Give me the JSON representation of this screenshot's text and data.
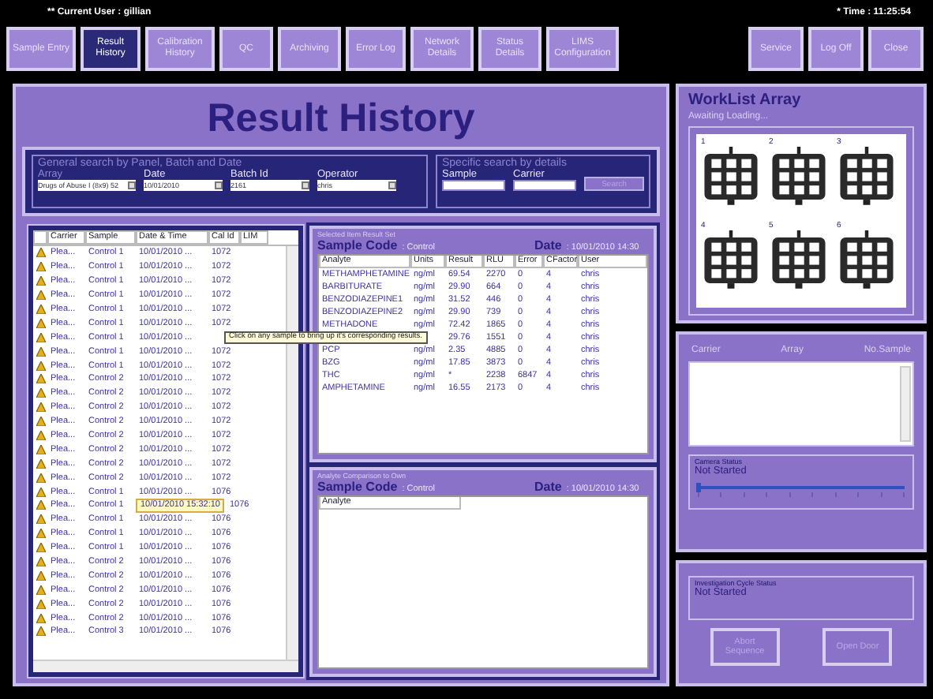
{
  "header": {
    "current_user": "** Current User : gillian",
    "time": "* Time : 11:25:54"
  },
  "nav": [
    {
      "label": "Sample Entry",
      "selected": false
    },
    {
      "label": "Result History",
      "selected": true
    },
    {
      "label": "Calibration History",
      "selected": false
    },
    {
      "label": "QC",
      "selected": false
    },
    {
      "label": "Archiving",
      "selected": false
    },
    {
      "label": "Error Log",
      "selected": false
    },
    {
      "label": "Network Details",
      "selected": false
    },
    {
      "label": "Status Details",
      "selected": false
    },
    {
      "label": "LIMS Configuration",
      "selected": false
    }
  ],
  "nav_right": [
    {
      "label": "Service"
    },
    {
      "label": "Log Off"
    },
    {
      "label": "Close"
    }
  ],
  "title": "Result History",
  "general_search": {
    "legend": "General search by Panel, Batch and Date",
    "fields": [
      {
        "label": "Array",
        "value": "Drugs of Abuse I (8x9) 52"
      },
      {
        "label": "Date",
        "value": "10/01/2010"
      },
      {
        "label": "Batch Id",
        "value": "2161"
      },
      {
        "label": "Operator",
        "value": "chris"
      }
    ]
  },
  "specific_search": {
    "legend": "Specific search by details",
    "fields": [
      {
        "label": "Sample"
      },
      {
        "label": "Carrier"
      }
    ],
    "button": {
      "label": "Search",
      "disabled": true
    }
  },
  "sample_list": {
    "columns": [
      "Carrier",
      "Sample",
      "Date & Time",
      "Cal Id",
      "LIM"
    ],
    "rows": [
      {
        "carrier": "Plea...",
        "sample": "Control 1",
        "datetime": "10/01/2010 ...",
        "cal_id": "1072",
        "selected": false
      },
      {
        "carrier": "Plea...",
        "sample": "Control 1",
        "datetime": "10/01/2010 ...",
        "cal_id": "1072",
        "selected": false
      },
      {
        "carrier": "Plea...",
        "sample": "Control 1",
        "datetime": "10/01/2010 ...",
        "cal_id": "1072",
        "selected": false
      },
      {
        "carrier": "Plea...",
        "sample": "Control 1",
        "datetime": "10/01/2010 ...",
        "cal_id": "1072",
        "selected": false
      },
      {
        "carrier": "Plea...",
        "sample": "Control 1",
        "datetime": "10/01/2010 ...",
        "cal_id": "1072",
        "selected": false
      },
      {
        "carrier": "Plea...",
        "sample": "Control 1",
        "datetime": "10/01/2010 ...",
        "cal_id": "1072",
        "selected": false
      },
      {
        "carrier": "Plea...",
        "sample": "Control 1",
        "datetime": "10/01/2010 ...",
        "selected": false
      },
      {
        "carrier": "Plea...",
        "sample": "Control 1",
        "datetime": "10/01/2010 ...",
        "cal_id": "1072",
        "selected": false
      },
      {
        "carrier": "Plea...",
        "sample": "Control 1",
        "datetime": "10/01/2010 ...",
        "cal_id": "1072",
        "selected": false
      },
      {
        "carrier": "Plea...",
        "sample": "Control 2",
        "datetime": "10/01/2010 ...",
        "cal_id": "1072",
        "selected": false
      },
      {
        "carrier": "Plea...",
        "sample": "Control 2",
        "datetime": "10/01/2010 ...",
        "cal_id": "1072",
        "selected": false
      },
      {
        "carrier": "Plea...",
        "sample": "Control 2",
        "datetime": "10/01/2010 ...",
        "cal_id": "1072",
        "selected": false
      },
      {
        "carrier": "Plea...",
        "sample": "Control 2",
        "datetime": "10/01/2010 ...",
        "cal_id": "1072",
        "selected": false
      },
      {
        "carrier": "Plea...",
        "sample": "Control 2",
        "datetime": "10/01/2010 ...",
        "cal_id": "1072",
        "selected": false
      },
      {
        "carrier": "Plea...",
        "sample": "Control 2",
        "datetime": "10/01/2010 ...",
        "cal_id": "1072",
        "selected": false
      },
      {
        "carrier": "Plea...",
        "sample": "Control 2",
        "datetime": "10/01/2010 ...",
        "cal_id": "1072",
        "selected": false
      },
      {
        "carrier": "Plea...",
        "sample": "Control 2",
        "datetime": "10/01/2010 ...",
        "cal_id": "1072",
        "selected": false
      },
      {
        "carrier": "Plea...",
        "sample": "Control 1",
        "datetime": "10/01/2010 ...",
        "cal_id": "1076",
        "selected": false
      },
      {
        "carrier": "Plea...",
        "sample": "Control 1",
        "datetime": "10/01/2010 15:32:10",
        "cal_id": "1076",
        "selected": true
      },
      {
        "carrier": "Plea...",
        "sample": "Control 1",
        "datetime": "10/01/2010 ...",
        "cal_id": "1076",
        "selected": false
      },
      {
        "carrier": "Plea...",
        "sample": "Control 1",
        "datetime": "10/01/2010 ...",
        "cal_id": "1076",
        "selected": false
      },
      {
        "carrier": "Plea...",
        "sample": "Control 1",
        "datetime": "10/01/2010 ...",
        "cal_id": "1076",
        "selected": false
      },
      {
        "carrier": "Plea...",
        "sample": "Control 2",
        "datetime": "10/01/2010 ...",
        "cal_id": "1076",
        "selected": false
      },
      {
        "carrier": "Plea...",
        "sample": "Control 2",
        "datetime": "10/01/2010 ...",
        "cal_id": "1076",
        "selected": false
      },
      {
        "carrier": "Plea...",
        "sample": "Control 2",
        "datetime": "10/01/2010 ...",
        "cal_id": "1076",
        "selected": false
      },
      {
        "carrier": "Plea...",
        "sample": "Control 2",
        "datetime": "10/01/2010 ...",
        "cal_id": "1076",
        "selected": false
      },
      {
        "carrier": "Plea...",
        "sample": "Control 2",
        "datetime": "10/01/2010 ...",
        "cal_id": "1076",
        "selected": false
      },
      {
        "carrier": "Plea...",
        "sample": "Control 3",
        "datetime": "10/01/2010 ...",
        "cal_id": "1076",
        "selected": false
      }
    ]
  },
  "tooltip": "Click on any sample to bring up it's corresponding results.",
  "result_set": {
    "legend": "Selected Item Result Set",
    "sample_code_label": "Sample Code",
    "sample_code": ": Control",
    "date_label": "Date",
    "date": ": 10/01/2010 14:30",
    "columns": [
      "Analyte",
      "Units",
      "Result",
      "RLU",
      "Error",
      "CFactor",
      "User"
    ],
    "rows": [
      [
        "METHAMPHETAMINE",
        "ng/ml",
        "69.54",
        "2270",
        "0",
        "4",
        "chris"
      ],
      [
        "BARBITURATE",
        "ng/ml",
        "29.90",
        "664",
        "0",
        "4",
        "chris"
      ],
      [
        "BENZODIAZEPINE1",
        "ng/ml",
        "31.52",
        "446",
        "0",
        "4",
        "chris"
      ],
      [
        "BENZODIAZEPINE2",
        "ng/ml",
        "29.90",
        "739",
        "0",
        "4",
        "chris"
      ],
      [
        "METHADONE",
        "ng/ml",
        "72.42",
        "1865",
        "0",
        "4",
        "chris"
      ],
      [
        "",
        "",
        "29.76",
        "1551",
        "0",
        "4",
        "chris"
      ],
      [
        "PCP",
        "ng/ml",
        "2.35",
        "4885",
        "0",
        "4",
        "chris"
      ],
      [
        "BZG",
        "ng/ml",
        "17.85",
        "3873",
        "0",
        "4",
        "chris"
      ],
      [
        "THC",
        "ng/ml",
        "*",
        "2238",
        "6847",
        "4",
        "chris"
      ],
      [
        "AMPHETAMINE",
        "ng/ml",
        "16.55",
        "2173",
        "0",
        "4",
        "chris"
      ]
    ]
  },
  "comparison": {
    "legend": "Analyte Comparison to Own",
    "sample_code_label": "Sample Code",
    "sample_code": ": Control",
    "date_label": "Date",
    "date": ": 10/01/2010 14:30",
    "columns": [
      "Analyte"
    ]
  },
  "worklist": {
    "title": "WorkList Array",
    "status": "Awaiting Loading...",
    "arrays": [
      "1",
      "2",
      "3",
      "4",
      "5",
      "6"
    ]
  },
  "carrier_list": {
    "columns": [
      "Carrier",
      "Array",
      "No.Sample"
    ]
  },
  "camera_status": {
    "legend": "Camera Status",
    "value": "Not Started",
    "level": 0
  },
  "cycle_status": {
    "legend": "Investigation Cycle Status",
    "value": "Not Started"
  },
  "buttons": [
    {
      "label": "Abort Sequence",
      "disabled": true
    },
    {
      "label": "Open Door",
      "disabled": true
    }
  ]
}
